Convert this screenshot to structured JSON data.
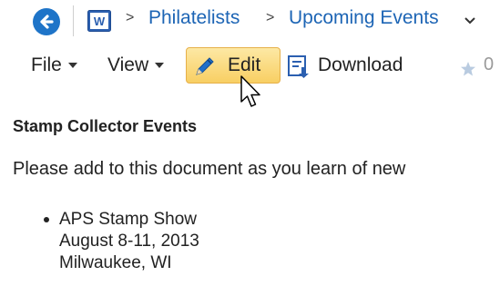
{
  "breadcrumb": {
    "separator": ">",
    "items": [
      "Philatelists",
      "Upcoming Events"
    ]
  },
  "toolbar": {
    "file_label": "File",
    "view_label": "View",
    "edit_label": "Edit",
    "download_label": "Download",
    "star_count": "0"
  },
  "document": {
    "heading": "Stamp Collector Events",
    "intro": "Please add to this document as you learn of new",
    "events": [
      {
        "name": "APS Stamp Show",
        "date": "August 8-11, 2013",
        "location": "Milwaukee, WI"
      }
    ]
  },
  "colors": {
    "link": "#1d65b5",
    "back_button": "#1e74c8",
    "edit_highlight": "#f8cf63",
    "word_icon": "#2b5fb0"
  },
  "icons": [
    "back-arrow-icon",
    "word-doc-icon",
    "chevron-down-icon",
    "pencil-icon",
    "download-icon",
    "star-icon",
    "mouse-cursor-icon"
  ]
}
